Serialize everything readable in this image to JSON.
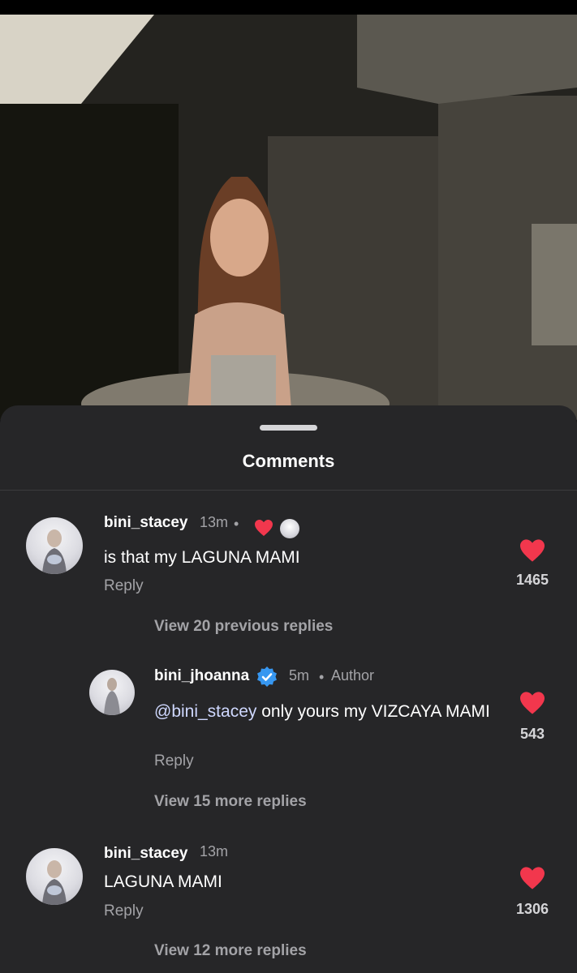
{
  "sheet": {
    "title": "Comments"
  },
  "comments": [
    {
      "username": "bini_stacey",
      "time": "13m",
      "dot": "•",
      "text": "is that my LAGUNA MAMI",
      "reply": "Reply",
      "likes": "1465",
      "view_replies": "View 20 previous replies"
    },
    {
      "username": "bini_jhoanna",
      "time": "5m",
      "dot": "•",
      "author": "Author",
      "mention": "@bini_stacey",
      "text": " only yours my VIZCAYA MAMI",
      "reply": "Reply",
      "likes": "543",
      "view_replies": "View 15 more replies"
    },
    {
      "username": "bini_stacey",
      "time": "13m",
      "text": "LAGUNA MAMI",
      "reply": "Reply",
      "likes": "1306",
      "view_replies": "View 12 more replies"
    }
  ],
  "colors": {
    "sheet_bg": "#262628",
    "like_red": "#f2374d",
    "verified_blue": "#3797f0",
    "muted_text": "#a3a3a7"
  },
  "icons": {
    "like": "heart-icon",
    "verified": "verified-badge-icon"
  }
}
